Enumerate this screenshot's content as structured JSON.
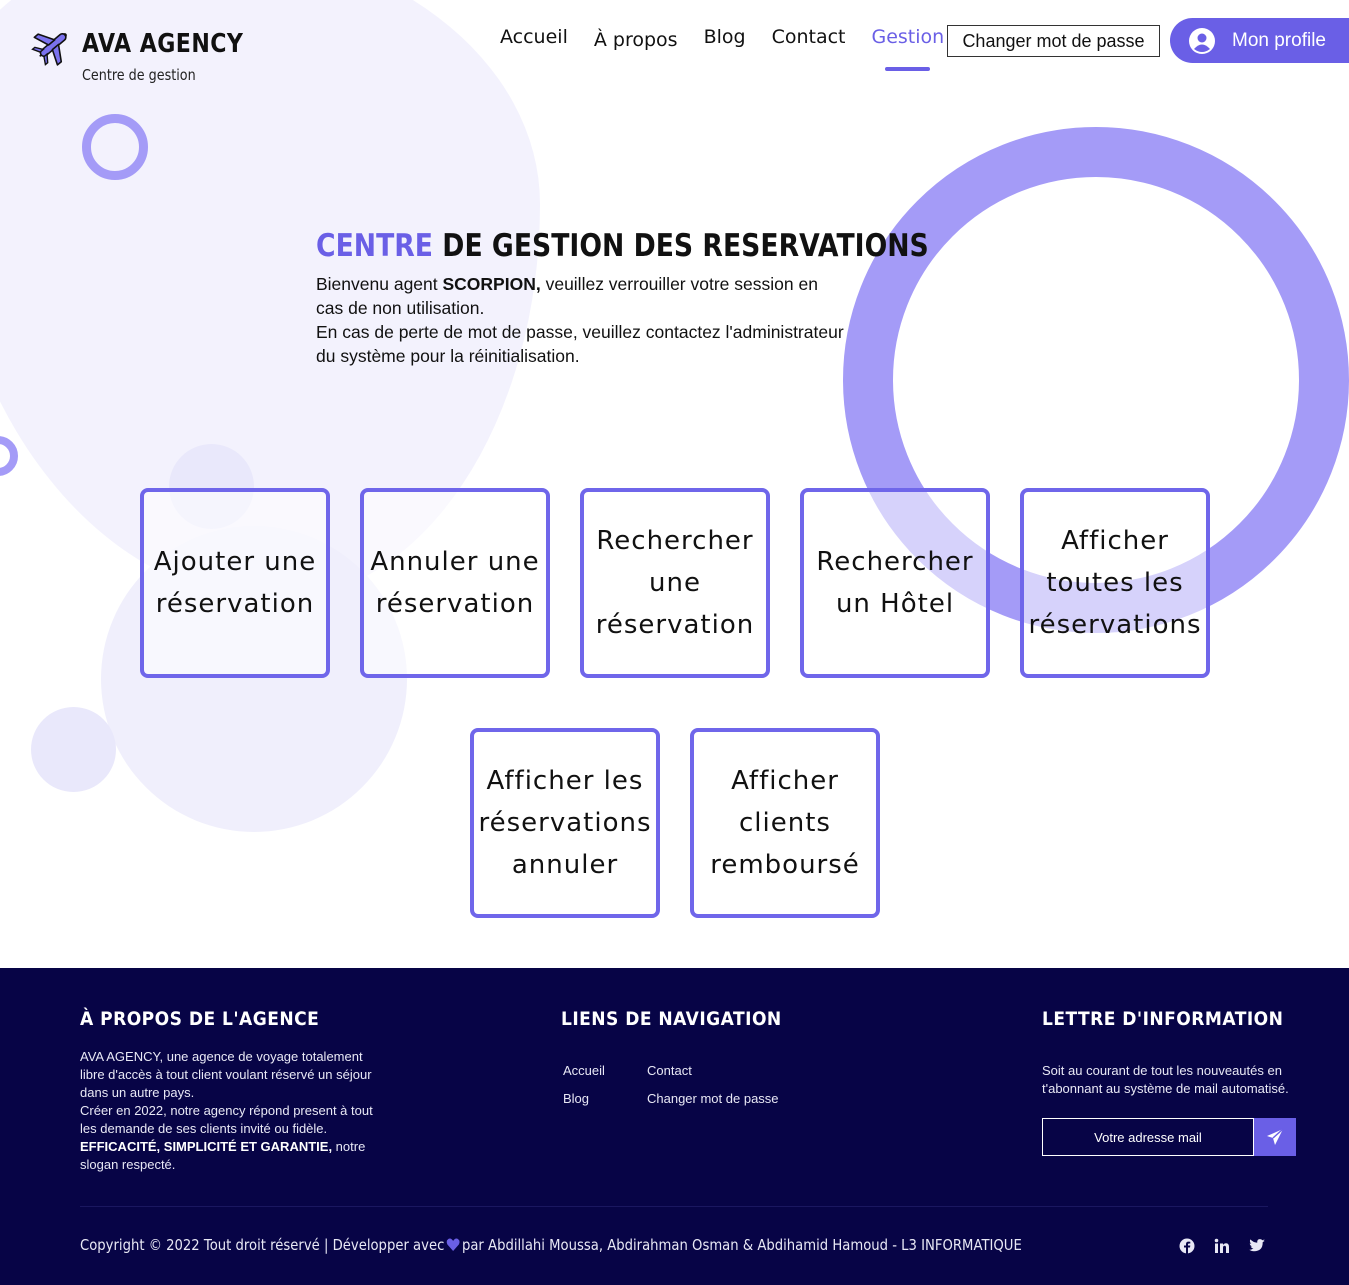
{
  "brand": {
    "title": "AVA AGENCY",
    "subtitle": "Centre de gestion"
  },
  "nav": {
    "items": [
      {
        "label": "Accueil"
      },
      {
        "label": "À propos"
      },
      {
        "label": "Blog"
      },
      {
        "label": "Contact"
      },
      {
        "label": "Gestion"
      }
    ],
    "active": "Gestion"
  },
  "header": {
    "change_password_label": "Changer mot de passe",
    "profile_label": "Mon profile"
  },
  "hero": {
    "title_accent": "CENTRE",
    "title_rest": " DE GESTION DES RESERVATIONS",
    "welcome_before": "Bienvenu agent ",
    "agent_name": "SCORPION,",
    "welcome_after": " veuillez verrouiller votre session en cas de non utilisation.",
    "lost_password": "En cas de perte de mot de passe, veuillez contactez l'administrateur du système pour la réinitialisation."
  },
  "actions": [
    {
      "label": "Ajouter une réservation"
    },
    {
      "label": "Annuler une réservation"
    },
    {
      "label": "Rechercher une réservation"
    },
    {
      "label": "Rechercher un Hôtel"
    },
    {
      "label": "Afficher toutes les réservations"
    },
    {
      "label": "Afficher les réservations annuler"
    },
    {
      "label": "Afficher clients remboursé"
    }
  ],
  "footer": {
    "about": {
      "heading": "À PROPOS DE L'AGENCE",
      "text1": "AVA AGENCY, une agence de voyage totalement libre d'accès à tout client voulant réservé un séjour dans un autre pays.",
      "text2": "Créer en 2022, notre agency répond present à tout les demande de ses clients invité ou fidèle.",
      "slogan": "EFFICACITÉ, SIMPLICITÉ ET GARANTIE,",
      "slogan_after": " notre slogan respecté."
    },
    "links": {
      "heading": "LIENS DE NAVIGATION",
      "items": [
        {
          "label": "Accueil"
        },
        {
          "label": "Contact"
        },
        {
          "label": "Blog"
        },
        {
          "label": "Changer mot de passe"
        }
      ]
    },
    "newsletter": {
      "heading": "LETTRE D'INFORMATION",
      "text": "Soit au courant de tout les nouveautés en t'abonnant au système de mail automatisé.",
      "placeholder": "Votre adresse mail"
    },
    "copyright_before": "Copyright © 2022 Tout droit réservé  |  Développer avec",
    "copyright_after": " par Abdillahi Moussa, Abdirahman Osman & Abdihamid Hamoud -  L3 INFORMATIQUE",
    "social": [
      "facebook-icon",
      "linkedin-icon",
      "twitter-icon"
    ]
  },
  "colors": {
    "accent": "#6a5fe6",
    "ring": "#a49bf7",
    "footer_bg": "#070446"
  }
}
